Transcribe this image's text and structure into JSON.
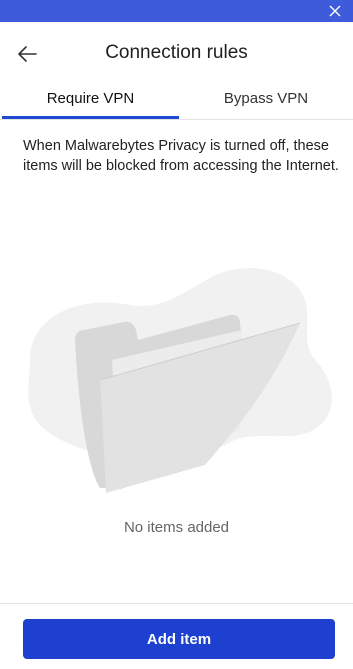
{
  "header": {
    "title": "Connection rules"
  },
  "tabs": [
    {
      "label": "Require VPN",
      "active": true
    },
    {
      "label": "Bypass VPN",
      "active": false
    }
  ],
  "description": "When Malwarebytes Privacy is turned off, these items will be blocked from accessing the Internet.",
  "empty_state": {
    "message": "No items added",
    "illustration": "empty-folder-icon"
  },
  "footer": {
    "add_label": "Add item"
  },
  "colors": {
    "titlebar": "#3d5bdb",
    "accent": "#1e40d0",
    "tab_underline": "#1e4bd2"
  },
  "icons": {
    "close": "close-icon",
    "back": "back-arrow-icon"
  }
}
